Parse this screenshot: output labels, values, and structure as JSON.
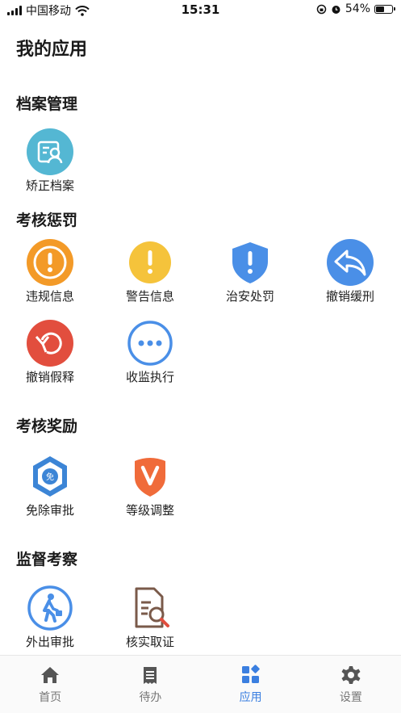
{
  "status": {
    "carrier": "中国移动",
    "time": "15:31",
    "battery": "54%",
    "battery_level": 0.54
  },
  "title": "我的应用",
  "sections": [
    {
      "title": "档案管理",
      "apps": [
        {
          "label": "矫正档案",
          "icon": "id-card-icon"
        }
      ]
    },
    {
      "title": "考核惩罚",
      "apps": [
        {
          "label": "违规信息",
          "icon": "exclamation-circle-icon"
        },
        {
          "label": "警告信息",
          "icon": "warning-icon"
        },
        {
          "label": "治安处罚",
          "icon": "shield-exclamation-icon"
        },
        {
          "label": "撤销缓刑",
          "icon": "revoke-arrow-icon"
        },
        {
          "label": "撤销假释",
          "icon": "undo-arrow-icon"
        },
        {
          "label": "收监执行",
          "icon": "more-dots-icon"
        }
      ]
    },
    {
      "title": "考核奖励",
      "apps": [
        {
          "label": "免除审批",
          "icon": "exempt-badge-icon"
        },
        {
          "label": "等级调整",
          "icon": "v-shield-icon"
        }
      ]
    },
    {
      "title": "监督考察",
      "apps": [
        {
          "label": "外出审批",
          "icon": "walking-person-icon"
        },
        {
          "label": "核实取证",
          "icon": "document-search-icon"
        }
      ]
    }
  ],
  "tabs": [
    {
      "label": "首页",
      "icon": "home-icon",
      "active": false
    },
    {
      "label": "待办",
      "icon": "todo-list-icon",
      "active": false
    },
    {
      "label": "应用",
      "icon": "apps-grid-icon",
      "active": true
    },
    {
      "label": "设置",
      "icon": "gear-icon",
      "active": false
    }
  ],
  "colors": {
    "accent": "#3b7fe0",
    "orange": "#f39a28",
    "yellow": "#f5c33b",
    "blue": "#4a8fe7",
    "red": "#e24e3e",
    "cyan": "#54b7d3",
    "brown": "#7a5a4a"
  }
}
